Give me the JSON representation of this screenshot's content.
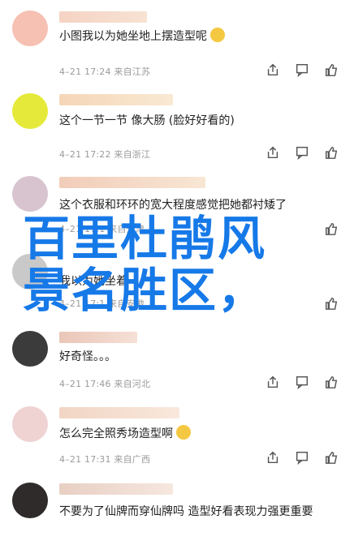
{
  "comments": [
    {
      "text": "小图我以为她坐地上摆造型呢",
      "emoji": true,
      "meta": "4–21 17:24 来自江苏",
      "avatar_bg": "#f6c0b2",
      "name_color": "#f0c2a8"
    },
    {
      "text": "这个一节一节 像大肠 (脸好好看的)",
      "emoji": false,
      "meta": "4–21 17:22 来自浙江",
      "avatar_bg": "#e5ea3a",
      "name_color": "#f3d0a9"
    },
    {
      "text": "这个衣服和环环的宽大程度感觉把她都衬矮了",
      "emoji": false,
      "meta": "4–21 17:1 来自天津",
      "avatar_bg": "#d8c4cf",
      "name_color": "#ecc7b8"
    },
    {
      "text": "我以为她坐着",
      "emoji": false,
      "meta": "4–21 17:1 来自安徽",
      "avatar_bg": "#c9c9c9",
      "name_color": "#d0d0d0"
    },
    {
      "text": "好奇怪。。。",
      "emoji": false,
      "meta": "4–21 17:46 来自河北",
      "avatar_bg": "#3b3b3b",
      "name_color": "#e8c4b4"
    },
    {
      "text": "怎么完全照秀场造型啊",
      "emoji": true,
      "meta": "4–21 17:31 来自广西",
      "avatar_bg": "#efd2d2",
      "name_color": "#f1d0b8"
    },
    {
      "text": "不要为了仙牌而穿仙牌吗 造型好看表现力强更重要",
      "emoji": false,
      "meta": "",
      "avatar_bg": "#2f2b2b",
      "name_color": "#e3c7ba"
    }
  ],
  "overlay": {
    "line1": "百里杜鹃风",
    "line2": "景名胜区，"
  },
  "icons": {
    "share": "share-icon",
    "comment": "comment-icon",
    "like": "thumbs-up-icon"
  }
}
